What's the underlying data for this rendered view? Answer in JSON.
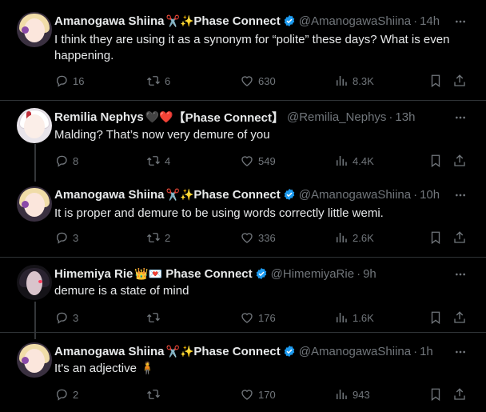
{
  "tweets": [
    {
      "name": "Amanogawa Shiina",
      "emoji": "✂️✨",
      "affiliation": "Phase Connect",
      "handle": "@AmanogawaShiina",
      "sep": "·",
      "time": "14h",
      "text": "I think they are using it as a synonym for “polite” these days? What is even happening.",
      "replies": "16",
      "retweets": "6",
      "likes": "630",
      "views": "8.3K"
    },
    {
      "name": "Remilia Nephys",
      "emoji": "🖤❤️",
      "affiliation": "【Phase Connect】",
      "handle": "@Remilia_Nephys",
      "sep": "·",
      "time": "13h",
      "text": "Malding? That’s now very demure of you",
      "replies": "8",
      "retweets": "4",
      "likes": "549",
      "views": "4.4K"
    },
    {
      "name": "Amanogawa Shiina",
      "emoji": "✂️✨",
      "affiliation": "Phase Connect",
      "handle": "@AmanogawaShiina",
      "sep": "·",
      "time": "10h",
      "text": "It is proper and demure to be using words correctly little wemi.",
      "replies": "3",
      "retweets": "2",
      "likes": "336",
      "views": "2.6K"
    },
    {
      "name": "Himemiya Rie",
      "emoji": "👑💌",
      "affiliation": "Phase Connect",
      "handle": "@HimemiyaRie",
      "sep": "·",
      "time": "9h",
      "text": "demure is a state of mind",
      "replies": "3",
      "retweets": "",
      "likes": "176",
      "views": "1.6K"
    },
    {
      "name": "Amanogawa Shiina",
      "emoji": "✂️✨",
      "affiliation": "Phase Connect",
      "handle": "@AmanogawaShiina",
      "sep": "·",
      "time": "1h",
      "text": "It's an adjective 🧍",
      "replies": "2",
      "retweets": "",
      "likes": "170",
      "views": "943"
    }
  ],
  "icons": {
    "verified": "verified-badge-icon",
    "more": "more-dots-icon",
    "reply": "reply-bubble-icon",
    "retweet": "retweet-arrows-icon",
    "like": "heart-icon",
    "views": "views-bars-icon",
    "bookmark": "bookmark-icon",
    "share": "share-arrow-icon"
  },
  "colors": {
    "background": "#000000",
    "text": "#e7e9ea",
    "secondary": "#71767b",
    "divider": "#2f3336",
    "verified": "#1d9bf0"
  }
}
